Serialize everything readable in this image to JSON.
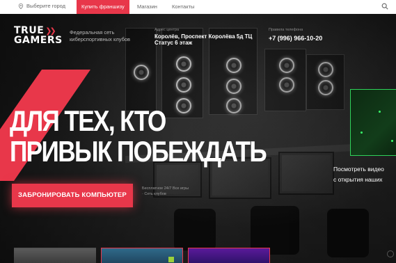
{
  "topbar": {
    "city_label": "Выберите город",
    "franchise_label": "Купить франшизу",
    "shop_label": "Магазин",
    "contacts_label": "Контакты"
  },
  "header": {
    "logo_line1": "TRUE",
    "logo_arrows": "❯❯",
    "logo_line2": "GAMERS",
    "tagline": "Федеральная сеть киберспортивных клубов",
    "address_caption": "Адрес центра",
    "address": "Королёв, Проспект Королёва 5д ТЦ Статус 6 этаж",
    "phone_caption": "Правила телефона",
    "phone": "+7 (996) 966-10-20"
  },
  "hero": {
    "headline_line1": "ДЛЯ ТЕХ, КТО",
    "headline_line2": "ПРИВЫК ПОБЕЖДАТЬ",
    "book_button": "ЗАБРОНИРОВАТЬ КОМПЬЮТЕР",
    "hours_text": "Бесплатное 24/7 Все игры · Сеть клубов",
    "video_caption_line1": "Посмотреть видео",
    "video_caption_line2": "с открытия наших"
  },
  "colors": {
    "accent": "#e8374a",
    "video_border": "#2fd35a"
  },
  "icons": {
    "location": "location-pin-icon",
    "search": "search-icon",
    "logo_arrows": "double-chevron-icon"
  }
}
